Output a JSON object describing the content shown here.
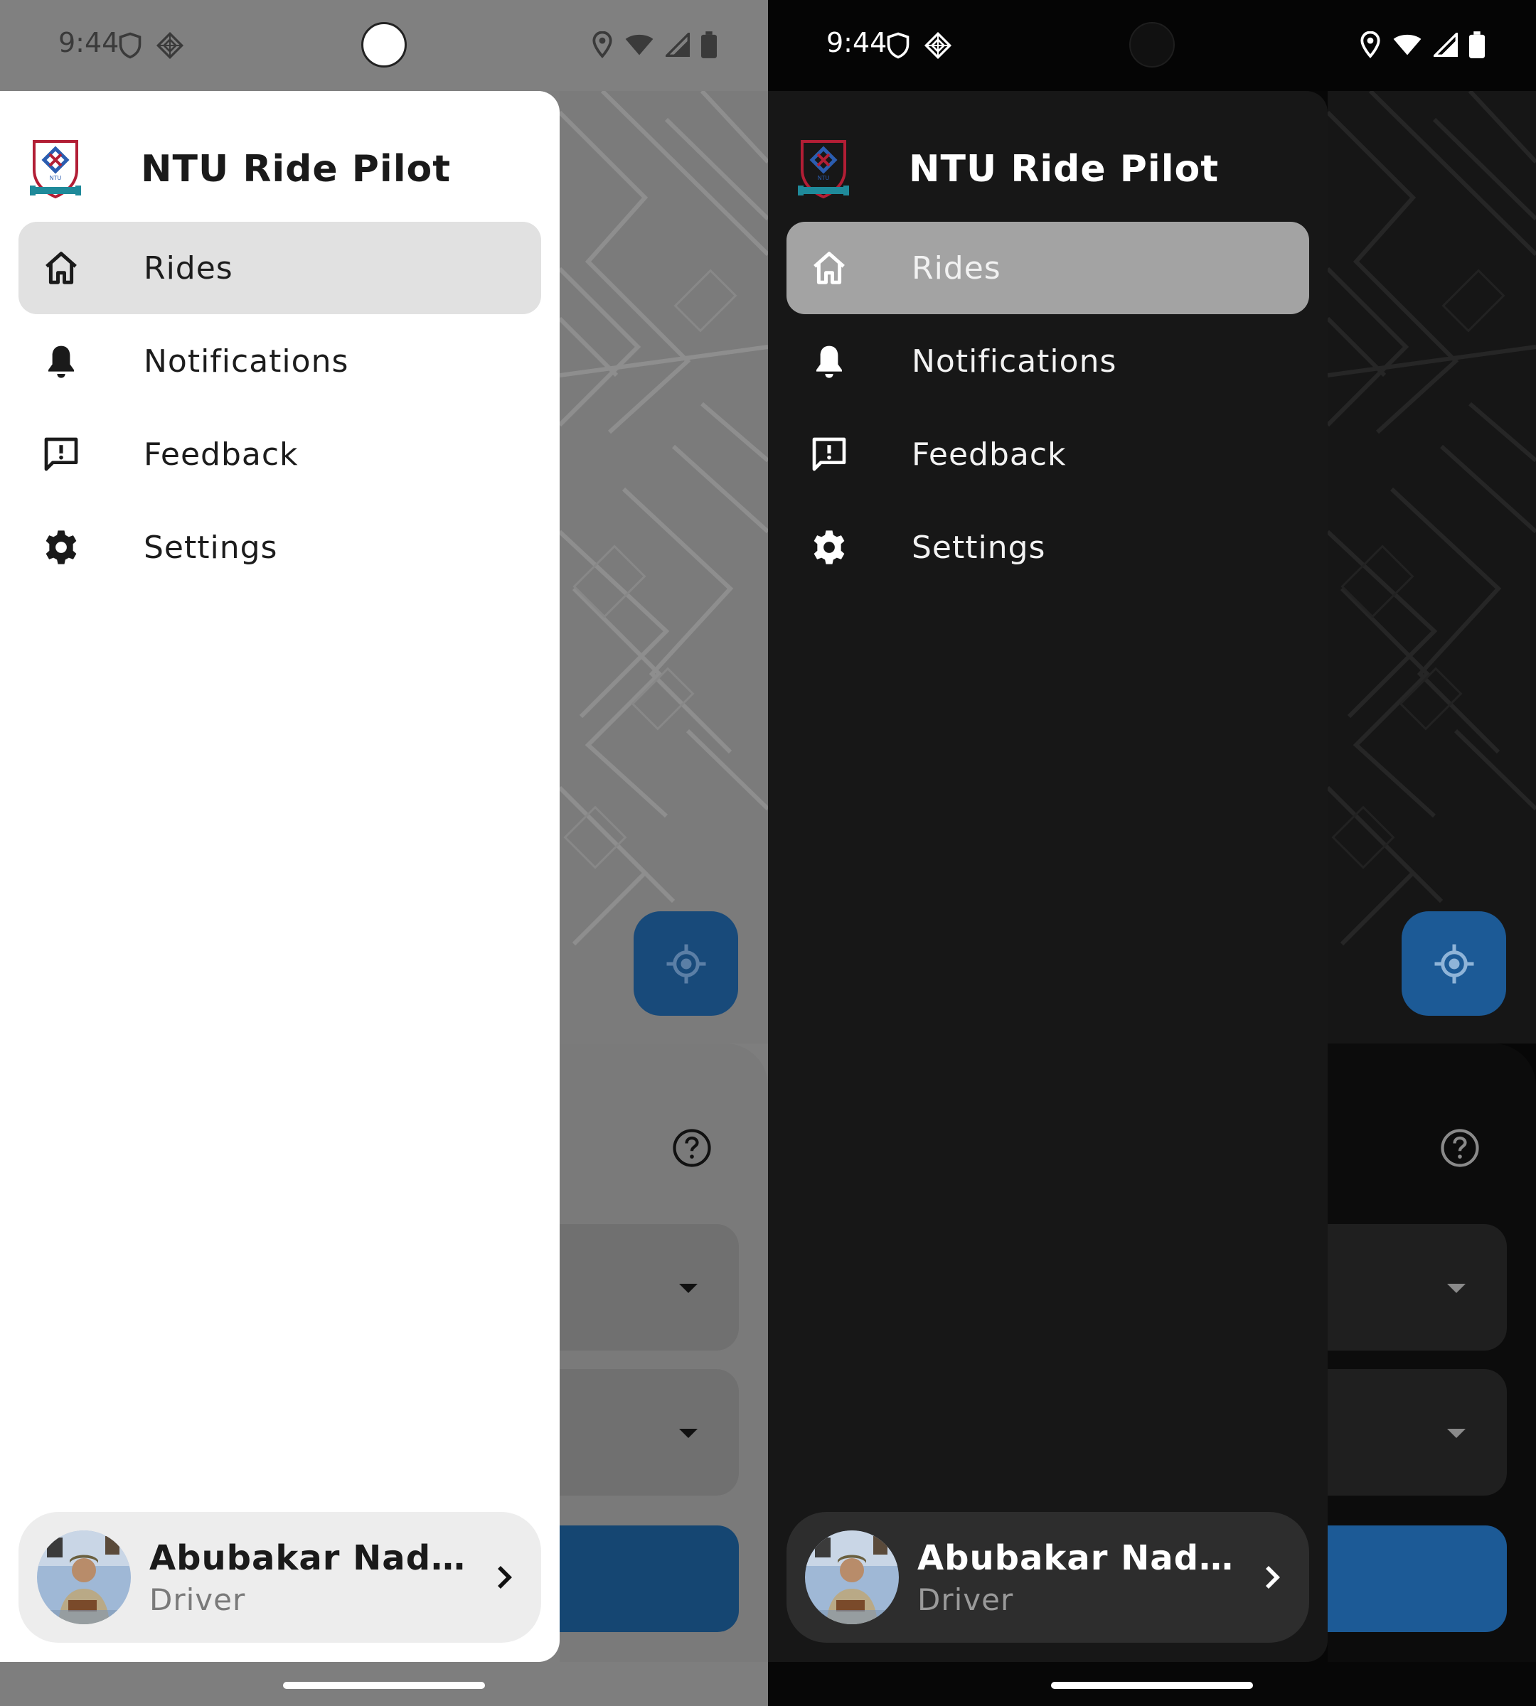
{
  "status_bar": {
    "time": "9:44",
    "left_icons": [
      "shield-icon",
      "diamond-grid-icon"
    ],
    "right_icons": [
      "location-icon",
      "wifi-icon",
      "signal-icon",
      "battery-icon"
    ]
  },
  "app": {
    "title": "NTU Ride Pilot",
    "logo": "ntu-crest-logo"
  },
  "nav": {
    "items": [
      {
        "id": "rides",
        "label": "Rides",
        "icon": "home-icon",
        "active": true
      },
      {
        "id": "notifications",
        "label": "Notifications",
        "icon": "bell-icon",
        "active": false
      },
      {
        "id": "feedback",
        "label": "Feedback",
        "icon": "feedback-icon",
        "active": false
      },
      {
        "id": "settings",
        "label": "Settings",
        "icon": "gear-icon",
        "active": false
      }
    ]
  },
  "profile": {
    "name": "Abubakar Nade...",
    "role": "Driver"
  },
  "background": {
    "fab_icon": "my-location-icon",
    "help_icon": "help-circle-icon",
    "dropdown_icon": "caret-down-icon"
  },
  "themes": {
    "light": {
      "accent": "#184a7a",
      "drawer": "#ffffff",
      "active_item": "#e1e1e1"
    },
    "dark": {
      "accent": "#1c5a96",
      "drawer": "#171717",
      "active_item": "#a3a3a3"
    }
  }
}
